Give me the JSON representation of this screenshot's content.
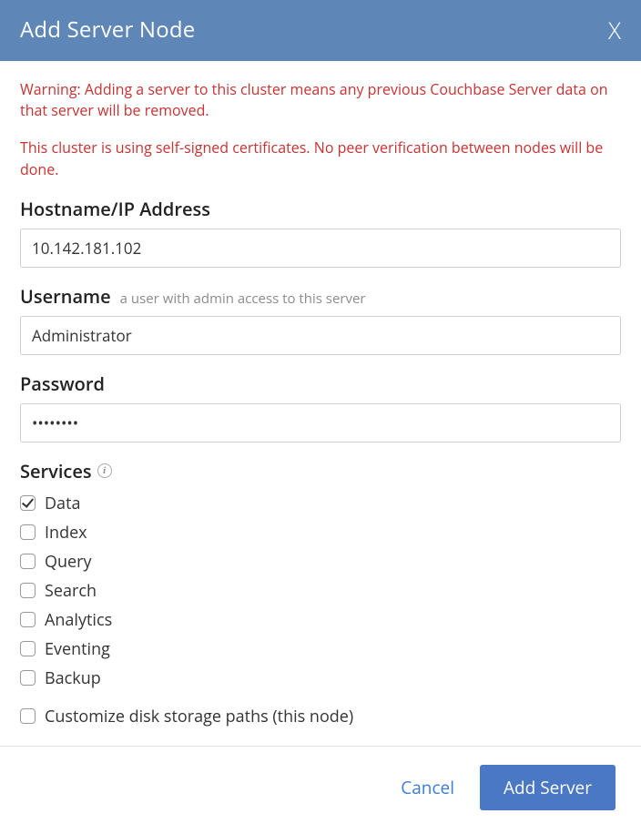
{
  "header": {
    "title": "Add Server Node",
    "close_glyph": "X"
  },
  "warnings": [
    "Warning: Adding a server to this cluster means any previous Couchbase Server data on that server will be removed.",
    "This cluster is using self-signed certificates. No peer verification between nodes will be done."
  ],
  "fields": {
    "hostname": {
      "label": "Hostname/IP Address",
      "value": "10.142.181.102"
    },
    "username": {
      "label": "Username",
      "hint": "a user with admin access to this server",
      "value": "Administrator"
    },
    "password": {
      "label": "Password",
      "value": "••••••••"
    }
  },
  "services": {
    "label": "Services",
    "info_glyph": "i",
    "items": [
      {
        "label": "Data",
        "checked": true
      },
      {
        "label": "Index",
        "checked": false
      },
      {
        "label": "Query",
        "checked": false
      },
      {
        "label": "Search",
        "checked": false
      },
      {
        "label": "Analytics",
        "checked": false
      },
      {
        "label": "Eventing",
        "checked": false
      },
      {
        "label": "Backup",
        "checked": false
      }
    ]
  },
  "customize": {
    "label": "Customize disk storage paths (this node)",
    "checked": false
  },
  "footer": {
    "cancel": "Cancel",
    "submit": "Add Server"
  }
}
